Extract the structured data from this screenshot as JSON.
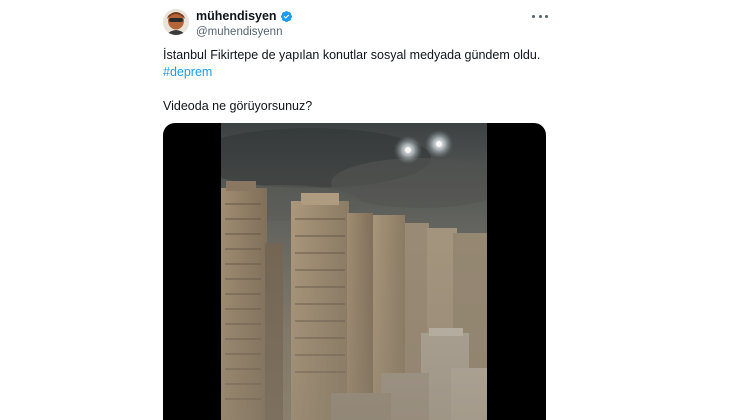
{
  "tweet": {
    "author": {
      "display_name": "mühendisyen",
      "handle": "@muhendisyenn",
      "verified": true,
      "avatar_icon": "avatar-icon",
      "verified_icon": "verified-badge-icon"
    },
    "more_icon": "more-options-icon",
    "text": {
      "line1": "İstanbul Fikirtepe de yapılan konutlar sosyal medyada gündem oldu.",
      "hashtag": "#deprem",
      "line2": "Videoda ne görüyorsunuz?"
    },
    "media": {
      "type": "video",
      "description_icon": "video-thumbnail"
    },
    "colors": {
      "link": "#1d9bf0",
      "verified": "#1d9bf0",
      "secondary_text": "#536471",
      "primary_text": "#0f1419"
    }
  }
}
